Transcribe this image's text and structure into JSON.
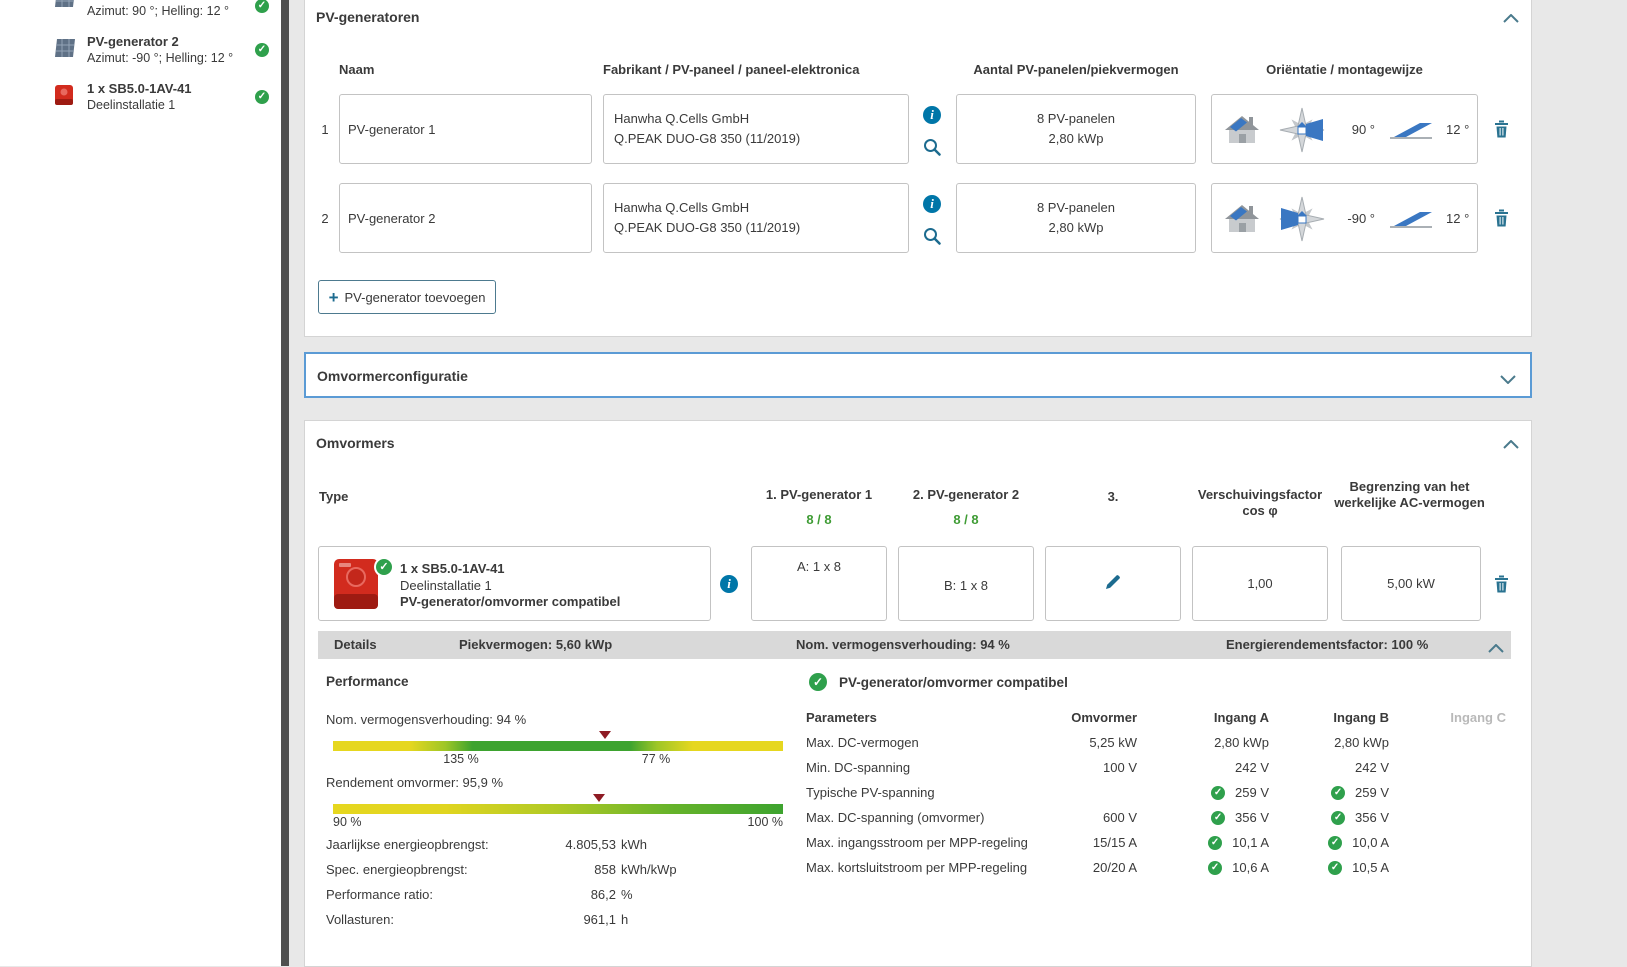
{
  "sidebar": {
    "item1": {
      "subtitle": "Azimut: 90 °; Helling: 12 °"
    },
    "item2": {
      "title": "PV-generator 2",
      "subtitle": "Azimut: -90 °; Helling: 12 °"
    },
    "item3": {
      "title": "1 x SB5.0-1AV-41",
      "subtitle": "Deelinstallatie 1"
    }
  },
  "generators": {
    "title": "PV-generatoren",
    "col_name": "Naam",
    "col_manufacturer": "Fabrikant / PV-paneel / paneel-elektronica",
    "col_panels": "Aantal PV-panelen/piekvermogen",
    "col_orientation": "Oriëntatie / montagewijze",
    "rows": [
      {
        "num": "1",
        "name": "PV-generator 1",
        "manufacturer": "Hanwha Q.Cells GmbH",
        "model": "Q.PEAK DUO-G8 350 (11/2019)",
        "count": "8 PV-panelen",
        "power": "2,80 kWp",
        "azimuth": "90 °",
        "tilt": "12 °"
      },
      {
        "num": "2",
        "name": "PV-generator 2",
        "manufacturer": "Hanwha Q.Cells GmbH",
        "model": "Q.PEAK DUO-G8 350 (11/2019)",
        "count": "8 PV-panelen",
        "power": "2,80 kWp",
        "azimuth": "-90 °",
        "tilt": "12 °"
      }
    ],
    "add_button": "PV-generator toevoegen"
  },
  "config": {
    "title": "Omvormerconfiguratie"
  },
  "inverters": {
    "title": "Omvormers",
    "col_type": "Type",
    "col_gen1": "1. PV-generator 1",
    "col_gen1_count": "8 / 8",
    "col_gen2": "2. PV-generator 2",
    "col_gen2_count": "8 / 8",
    "col_gen3": "3.",
    "col_cos1": "Verschuivingsfactor",
    "col_cos2": "cos φ",
    "col_ac": "Begrenzing van het werkelijke AC-vermogen",
    "row": {
      "name": "1 x SB5.0-1AV-41",
      "sub": "Deelinstallatie 1",
      "status": "PV-generator/omvormer compatibel",
      "input_a": "A: 1 x 8",
      "input_b": "B: 1 x 8",
      "cos_phi": "1,00",
      "ac_limit": "5,00 kW"
    },
    "bar": {
      "details": "Details",
      "peak": "Piekvermogen: 5,60 kWp",
      "ratio": "Nom. vermogensverhouding: 94 %",
      "factor": "Energierendementsfactor: 100 %"
    }
  },
  "performance": {
    "title": "Performance",
    "bar1_label": "Nom. vermogensverhouding: 94 %",
    "bar1_tick1": "135 %",
    "bar1_tick2": "77 %",
    "bar2_label": "Rendement omvormer: 95,9 %",
    "bar2_tick1": "90 %",
    "bar2_tick2": "100 %",
    "kv": [
      {
        "label": "Jaarlijkse energieopbrengst:",
        "value": "4.805,53",
        "unit": "kWh"
      },
      {
        "label": "Spec. energieopbrengst:",
        "value": "858",
        "unit": "kWh/kWp"
      },
      {
        "label": "Performance ratio:",
        "value": "86,2",
        "unit": "%"
      },
      {
        "label": "Vollasturen:",
        "value": "961,1",
        "unit": "h"
      }
    ]
  },
  "compat": {
    "status": "PV-generator/omvormer compatibel",
    "h_params": "Parameters",
    "h_omv": "Omvormer",
    "h_a": "Ingang A",
    "h_b": "Ingang B",
    "h_c": "Ingang C",
    "rows": [
      {
        "label": "Max. DC-vermogen",
        "omv": "5,25 kW",
        "a": "2,80 kWp",
        "b": "2,80 kWp"
      },
      {
        "label": "Min. DC-spanning",
        "omv": "100 V",
        "a": "242 V",
        "b": "242 V"
      },
      {
        "label": "Typische PV-spanning",
        "omv": "",
        "a": "259 V",
        "b": "259 V"
      },
      {
        "label": "Max. DC-spanning (omvormer)",
        "omv": "600 V",
        "a": "356 V",
        "b": "356 V"
      },
      {
        "label": "Max. ingangsstroom per MPP-regeling",
        "omv": "15/15 A",
        "a": "10,1 A",
        "b": "10,0 A"
      },
      {
        "label": "Max. kortsluitstroom per MPP-regeling",
        "omv": "20/20 A",
        "a": "10,6 A",
        "b": "10,5 A"
      }
    ]
  },
  "colors": {
    "accent_green": "#2fa04c",
    "accent_blue": "#0076a8",
    "icon_teal": "#1c6b8f",
    "selected_border": "#5b9bd5",
    "inverter_red": "#d22b1e"
  }
}
